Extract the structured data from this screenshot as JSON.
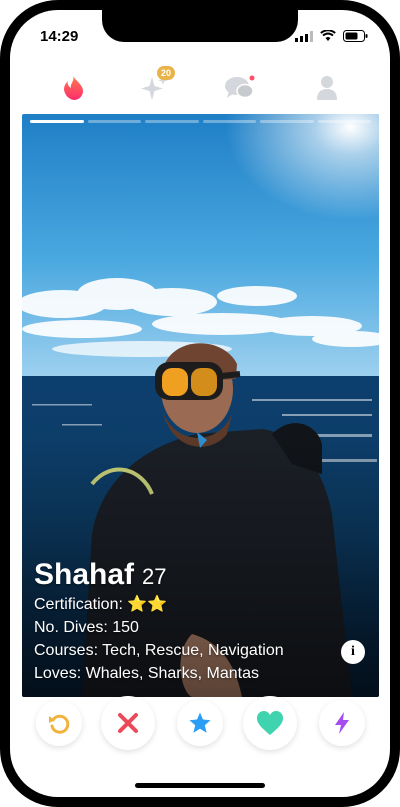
{
  "status": {
    "time": "14:29"
  },
  "nav": {
    "items": [
      {
        "name": "flame-icon"
      },
      {
        "name": "sparkle-icon",
        "badge": "20"
      },
      {
        "name": "messages-icon"
      },
      {
        "name": "profile-icon"
      }
    ]
  },
  "profile": {
    "name": "Shahaf",
    "age": "27",
    "certification_label": "Certification:",
    "certification_stars": "⭐⭐",
    "dives": "No. Dives: 150",
    "courses": "Courses: Tech, Rescue, Navigation",
    "loves": "Loves: Whales, Sharks, Mantas",
    "photo_count": 6,
    "active_photo": 0
  },
  "actions": [
    {
      "name": "rewind-button",
      "icon": "rewind-icon",
      "color": "#f2b33d"
    },
    {
      "name": "nope-button",
      "icon": "close-icon",
      "color": "#ea4a5a"
    },
    {
      "name": "super-like-button",
      "icon": "star-icon",
      "color": "#2a9df4"
    },
    {
      "name": "like-button",
      "icon": "heart-icon",
      "color": "#3fd3b0"
    },
    {
      "name": "boost-button",
      "icon": "lightning-icon",
      "color": "#a44ef1"
    }
  ],
  "colors": {
    "brand": "#fd5068",
    "badge": "#e9b349"
  }
}
